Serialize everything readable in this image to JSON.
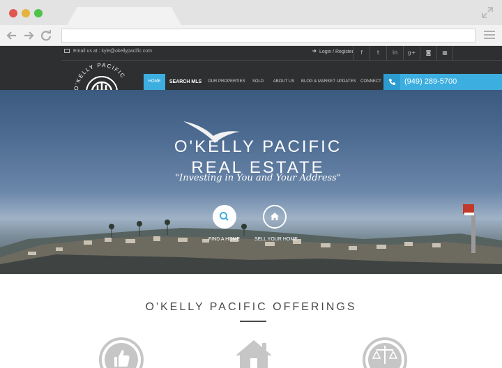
{
  "browser": {
    "url": ""
  },
  "topbar": {
    "email": "Email us at : kyle@okellypacific.com",
    "login": "Login / Register",
    "social": [
      {
        "icon": "facebook-icon",
        "glyph": "f"
      },
      {
        "icon": "twitter-icon",
        "glyph": "t"
      },
      {
        "icon": "linkedin-icon",
        "glyph": "in"
      },
      {
        "icon": "google-plus-icon",
        "glyph": "g+"
      },
      {
        "icon": "instagram-icon",
        "glyph": "◙"
      },
      {
        "icon": "calendar-icon",
        "glyph": "▦"
      }
    ]
  },
  "logo": {
    "text": "O'KELLY PACIFIC"
  },
  "nav": {
    "items": [
      {
        "label": "HOME",
        "active": true
      },
      {
        "label": "SEARCH MLS",
        "bold": true
      },
      {
        "label": "OUR PROPERTIES"
      },
      {
        "label": "SOLD"
      },
      {
        "label": "ABOUT US"
      },
      {
        "label": "BLOG & MARKET UPDATES"
      },
      {
        "label": "CONNECT"
      }
    ],
    "phone": "(949) 289-5700"
  },
  "hero": {
    "title_line1": "O'KELLY PACIFIC",
    "title_line2": "REAL ESTATE",
    "tagline": "\"Investing in You and Your Address\"",
    "find_label": "FIND A HOME",
    "sell_label": "SELL YOUR HOME"
  },
  "offerings": {
    "title": "O'KELLY PACIFIC OFFERINGS",
    "icons": [
      "thumbs-up-icon",
      "house-icon",
      "scales-icon"
    ]
  },
  "colors": {
    "accent": "#3daee0",
    "header_bg": "#2d2f30"
  }
}
